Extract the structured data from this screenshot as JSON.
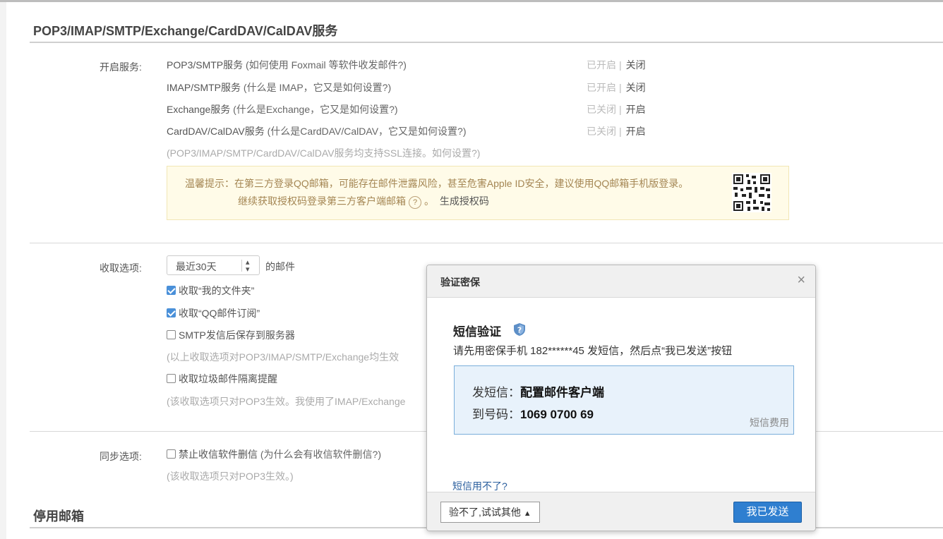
{
  "section_title": "POP3/IMAP/SMTP/Exchange/CardDAV/CalDAV服务",
  "open_services_label": "开启服务:",
  "services": [
    {
      "name": "POP3/SMTP服务",
      "help": "(如何使用 Foxmail 等软件收发邮件?)",
      "status": "已开启",
      "action": "关闭"
    },
    {
      "name": "IMAP/SMTP服务",
      "help": "(什么是 IMAP，它又是如何设置?)",
      "status": "已开启",
      "action": "关闭"
    },
    {
      "name": "Exchange服务",
      "help": "(什么是Exchange，它又是如何设置?)",
      "status": "已关闭",
      "action": "开启"
    },
    {
      "name": "CardDAV/CalDAV服务",
      "help": "(什么是CardDAV/CalDAV，它又是如何设置?)",
      "status": "已关闭",
      "action": "开启"
    }
  ],
  "ssl_note": "(POP3/IMAP/SMTP/CardDAV/CalDAV服务均支持SSL连接。如何设置?)",
  "tip": {
    "line1": "温馨提示：在第三方登录QQ邮箱，可能存在邮件泄露风险，甚至危害Apple ID安全，建议使用QQ邮箱手机版登录。",
    "line2_a": "继续获取授权码登录第三方客户端邮箱",
    "line2_q": "?",
    "line2_b": "。",
    "gen_link": "生成授权码"
  },
  "receive": {
    "label": "收取选项:",
    "select_value": "最近30天",
    "suffix": "的邮件",
    "opt1": "收取“我的文件夹”",
    "opt2": "收取“QQ邮件订阅”",
    "opt3": "SMTP发信后保存到服务器",
    "note1": "(以上收取选项对POP3/IMAP/SMTP/Exchange均生效",
    "opt4": "收取垃圾邮件隔离提醒",
    "note2": "(该收取选项只对POP3生效。我使用了IMAP/Exchange"
  },
  "sync": {
    "label": "同步选项:",
    "opt1": "禁止收信软件删信",
    "opt1_help": "(为什么会有收信软件删信?)",
    "note": "(该收取选项只对POP3生效。)"
  },
  "disable_title": "停用邮箱",
  "dialog": {
    "title": "验证密保",
    "close": "×",
    "heading": "短信验证",
    "desc": "请先用密保手机 182******45 发短信，然后点“我已发送”按钮",
    "send_label": "发短信：",
    "send_value": "配置邮件客户端",
    "to_label": "到号码：",
    "to_value": "1069 0700 69",
    "fee": "短信费用",
    "cant": "短信用不了?",
    "other_btn": "验不了,试试其他",
    "sent_btn": "我已发送"
  }
}
